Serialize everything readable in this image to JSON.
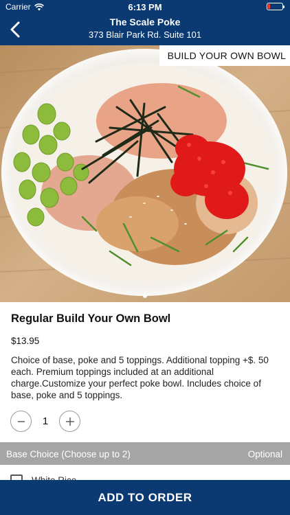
{
  "status_bar": {
    "carrier": "Carrier",
    "time": "6:13 PM",
    "battery_level": 0.15,
    "battery_color": "#ff3b30"
  },
  "nav": {
    "title": "The Scale Poke",
    "subtitle": "373 Blair Park Rd. Suite 101",
    "back_icon": "chevron-left-icon",
    "bg_color": "#0b3a73"
  },
  "hero": {
    "badge": "BUILD YOUR OWN BOWL",
    "image_description_icon": "poke-bowl-photo",
    "page_indicator": {
      "current": 1,
      "total": 1
    }
  },
  "item": {
    "name": "Regular Build Your Own Bowl",
    "price": "$13.95",
    "description": "Choice of base, poke and 5 toppings. Additional topping +$. 50 each. Premium toppings included at an additional charge.Customize your perfect poke bowl. Includes choice of base, poke and 5 toppings."
  },
  "quantity": {
    "value": "1",
    "minus_icon": "minus-icon",
    "plus_icon": "plus-icon"
  },
  "section": {
    "title": "Base Choice (Choose up to 2)",
    "note": "Optional"
  },
  "options": [
    {
      "label": "White Rice",
      "checked": false
    }
  ],
  "footer": {
    "add_to_order_label": "ADD TO ORDER"
  }
}
